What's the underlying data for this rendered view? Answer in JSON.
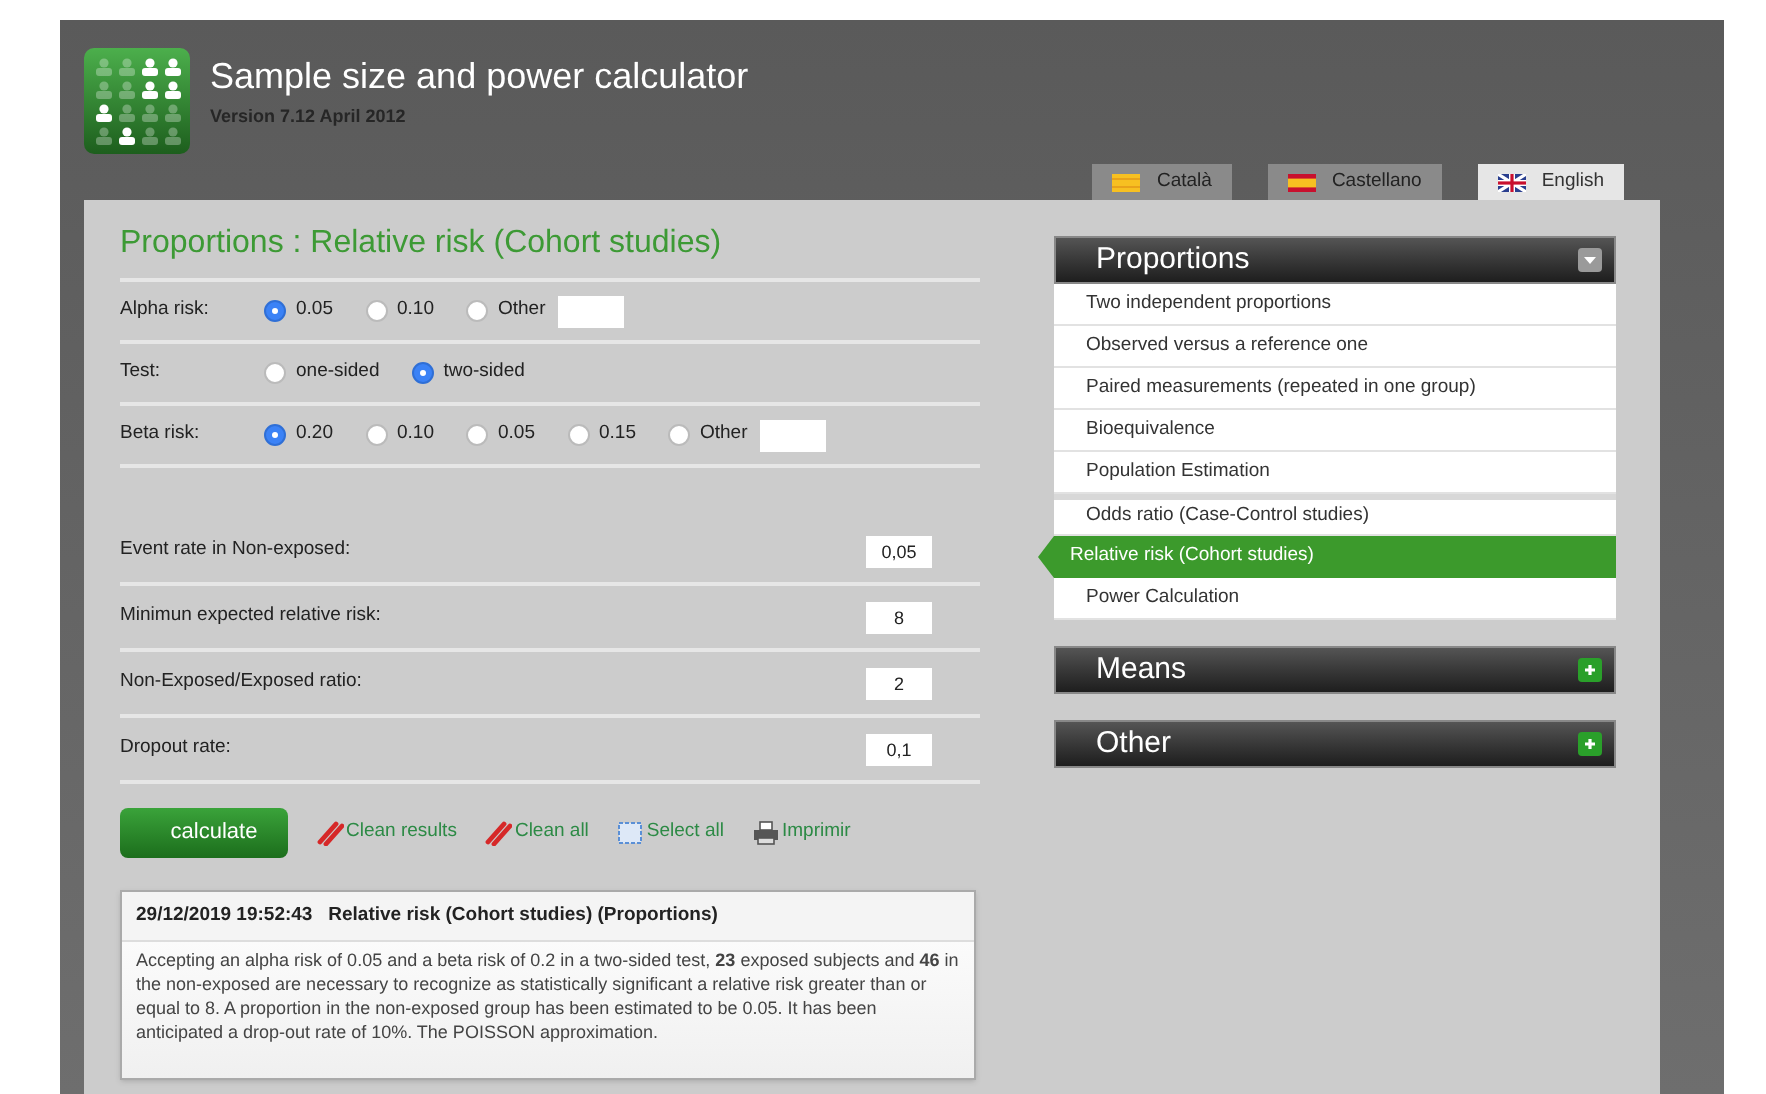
{
  "header": {
    "title": "Sample size and power calculator",
    "version": "Version 7.12 April 2012"
  },
  "language_tabs": [
    {
      "label": "Català",
      "kind": "catalan",
      "selected": false
    },
    {
      "label": "Castellano",
      "kind": "spanish",
      "selected": false
    },
    {
      "label": "English",
      "kind": "uk",
      "selected": true
    }
  ],
  "form": {
    "title": "Proportions : Relative risk (Cohort studies)",
    "radio_groups": [
      {
        "label": "Alpha risk:",
        "options": [
          {
            "label": "0.05",
            "kind": "value",
            "selected": true
          },
          {
            "label": "0.10",
            "kind": "value",
            "selected": false
          },
          {
            "label": "Other",
            "kind": "other",
            "selected": false
          }
        ]
      },
      {
        "label": "Test:",
        "options": [
          {
            "label": "one-sided",
            "kind": "value",
            "selected": false
          },
          {
            "label": "two-sided",
            "kind": "value",
            "selected": true
          }
        ]
      },
      {
        "label": "Beta risk:",
        "options": [
          {
            "label": "0.20",
            "kind": "value",
            "selected": true
          },
          {
            "label": "0.10",
            "kind": "value",
            "selected": false
          },
          {
            "label": "0.05",
            "kind": "value",
            "selected": false
          },
          {
            "label": "0.15",
            "kind": "value",
            "selected": false
          },
          {
            "label": "Other",
            "kind": "other",
            "selected": false
          }
        ]
      }
    ],
    "fields": [
      {
        "label": "Event rate in Non-exposed:",
        "value": "0,05"
      },
      {
        "label": "Minimun expected relative risk:",
        "value": "8"
      },
      {
        "label": "Non-Exposed/Exposed ratio:",
        "value": "2"
      },
      {
        "label": "Dropout rate:",
        "value": "0,1"
      }
    ],
    "calculate_button": "calculate",
    "actions": [
      {
        "label": "Clean results",
        "kind": "eraser"
      },
      {
        "label": "Clean all",
        "kind": "eraser"
      },
      {
        "label": "Select all",
        "kind": "select"
      },
      {
        "label": "Imprimir",
        "kind": "printer"
      }
    ]
  },
  "result": {
    "heading": "29/12/2019 19:52:43   Relative risk (Cohort studies) (Proportions)",
    "text": "Accepting an alpha risk of 0.05 and a beta risk of 0.2 in a two-sided test, **23** exposed subjects and **46** in the non-exposed are necessary to recognize as statistically significant a relative risk greater than or equal to 8. A proportion in the non-exposed group has been estimated to be 0.05. It has been anticipated a drop-out rate of 10%. The POISSON approximation."
  },
  "sidebar": [
    {
      "title": "Proportions",
      "expanded": true,
      "items": [
        {
          "label": "Two independent proportions",
          "selected": false,
          "group_start": false
        },
        {
          "label": "Observed versus a reference one",
          "selected": false,
          "group_start": false
        },
        {
          "label": "Paired measurements (repeated in one group)",
          "selected": false,
          "group_start": false
        },
        {
          "label": "Bioequivalence",
          "selected": false,
          "group_start": false
        },
        {
          "label": "Population Estimation",
          "selected": false,
          "group_start": false
        },
        {
          "label": "Odds ratio (Case-Control studies)",
          "selected": false,
          "group_start": true
        },
        {
          "label": "Relative risk (Cohort studies)",
          "selected": true,
          "group_start": false
        },
        {
          "label": "Power Calculation",
          "selected": false,
          "group_start": false
        }
      ]
    },
    {
      "title": "Means",
      "expanded": false
    },
    {
      "title": "Other",
      "expanded": false
    }
  ]
}
